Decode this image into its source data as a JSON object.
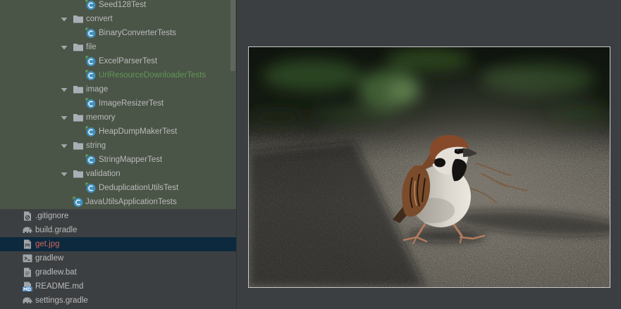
{
  "theme": {
    "tree_bg": "#3c3f41",
    "tree_test_sources_bg": "#4a5447",
    "editor_bg": "#3c3f41",
    "selection_bg": "#0d293e",
    "text": "#bbbbbb"
  },
  "project_tree": {
    "items": [
      {
        "label": "Seed128Test",
        "icon": "test-class-icon"
      },
      {
        "label": "convert",
        "icon": "folder-icon",
        "expanded": true
      },
      {
        "label": "BinaryConverterTests",
        "icon": "test-class-icon"
      },
      {
        "label": "file",
        "icon": "folder-icon",
        "expanded": true
      },
      {
        "label": "ExcelParserTest",
        "icon": "test-class-icon"
      },
      {
        "label": "UrlResourceDownloaderTests",
        "icon": "test-class-icon",
        "color": "#629755"
      },
      {
        "label": "image",
        "icon": "folder-icon",
        "expanded": true
      },
      {
        "label": "ImageResizerTest",
        "icon": "test-class-icon"
      },
      {
        "label": "memory",
        "icon": "folder-icon",
        "expanded": true
      },
      {
        "label": "HeapDumpMakerTest",
        "icon": "test-class-icon"
      },
      {
        "label": "string",
        "icon": "folder-icon",
        "expanded": true
      },
      {
        "label": "StringMapperTest",
        "icon": "test-class-icon"
      },
      {
        "label": "validation",
        "icon": "folder-icon",
        "expanded": true
      },
      {
        "label": "DeduplicationUtilsTest",
        "icon": "test-class-icon"
      },
      {
        "label": "JavaUtilsApplicationTests",
        "icon": "test-class-icon"
      },
      {
        "label": ".gitignore",
        "icon": "ignore-file-icon"
      },
      {
        "label": "build.gradle",
        "icon": "gradle-icon"
      },
      {
        "label": "get.jpg",
        "icon": "image-file-icon",
        "selected": true,
        "color": "#d1675a"
      },
      {
        "label": "gradlew",
        "icon": "shell-script-icon"
      },
      {
        "label": "gradlew.bat",
        "icon": "text-file-icon"
      },
      {
        "label": "README.md",
        "icon": "markdown-file-icon"
      },
      {
        "label": "settings.gradle",
        "icon": "gradle-icon"
      }
    ]
  }
}
